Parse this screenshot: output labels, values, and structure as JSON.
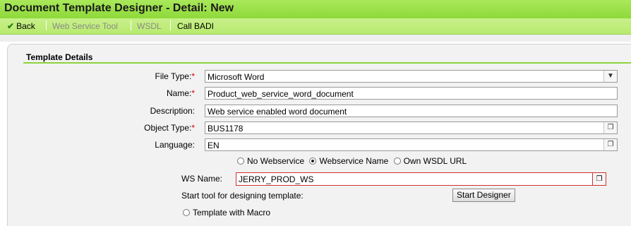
{
  "window": {
    "title": "Document Template Designer - Detail: New"
  },
  "toolbar": {
    "back_label": "Back",
    "web_service_tool_label": "Web Service Tool",
    "wsdl_label": "WSDL",
    "call_badi_label": "Call BADI"
  },
  "section": {
    "title": "Template Details"
  },
  "form": {
    "required_mark": "*",
    "file_type": {
      "label": "File Type:",
      "value": "Microsoft Word"
    },
    "name": {
      "label": "Name:",
      "value": "Product_web_service_word_document"
    },
    "description": {
      "label": "Description:",
      "value": "Web service enabled word document"
    },
    "object_type": {
      "label": "Object Type:",
      "value": "BUS1178"
    },
    "language": {
      "label": "Language:",
      "value": "EN"
    }
  },
  "webservice_options": {
    "no_webservice": "No Webservice",
    "webservice_name": "Webservice Name",
    "own_wsdl_url": "Own WSDL URL",
    "selected": "webservice_name"
  },
  "ws_name": {
    "label": "WS Name:",
    "value": "JERRY_PROD_WS"
  },
  "designer": {
    "label": "Start tool for designing template:",
    "button_label": "Start Designer"
  },
  "macro": {
    "label": "Template with Macro"
  },
  "icons": {
    "back": "check-icon",
    "value_help": "value-help-icon",
    "dropdown": "chevron-down-icon"
  },
  "colors": {
    "title_bar": "#8fd93a",
    "toolbar": "#c8f08a",
    "accent_line": "#8cd43c",
    "required": "#d00000",
    "error_border": "#d23030"
  }
}
